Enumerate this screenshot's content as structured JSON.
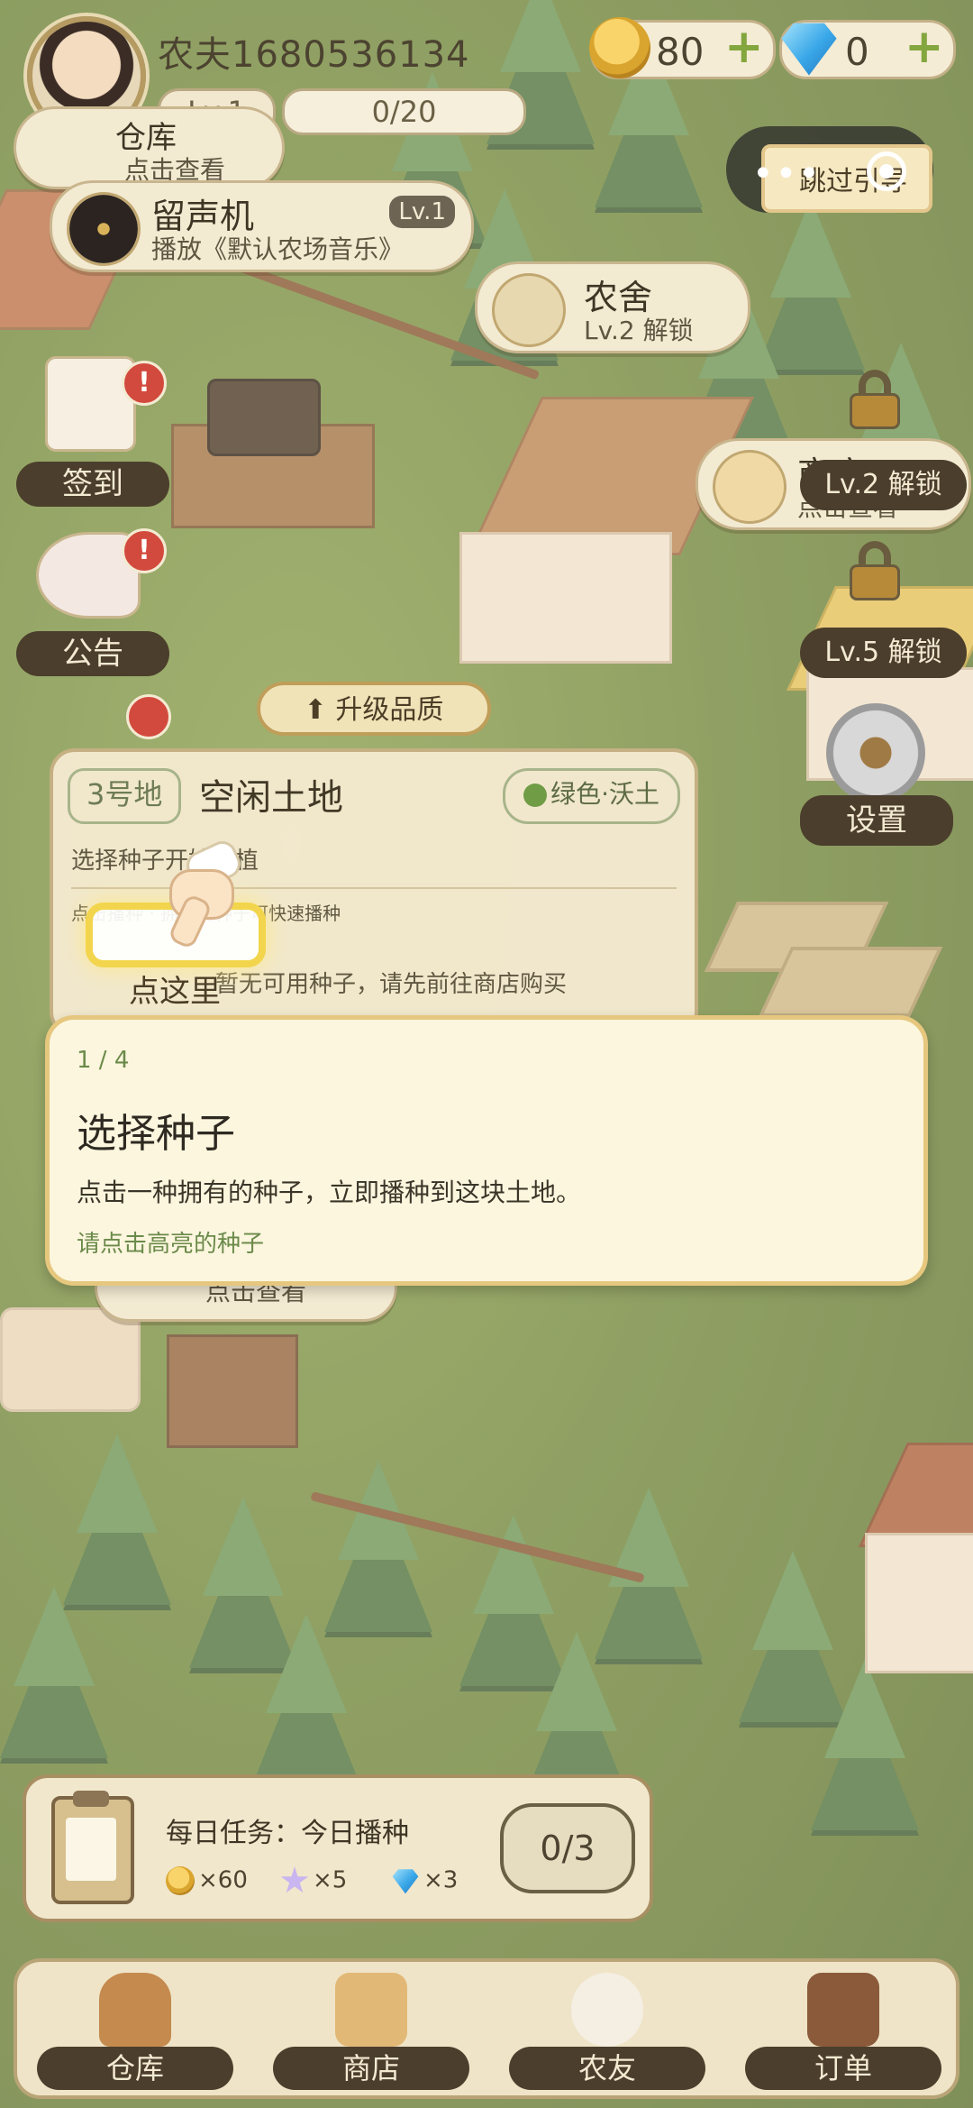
{
  "player": {
    "name": "农夫1680536134",
    "level": "Lv.1",
    "xp": "0/20"
  },
  "resources": {
    "coins": "80",
    "gems": "0"
  },
  "skip": {
    "label": "跳过引导"
  },
  "buildings": {
    "warehouse": {
      "title": "仓库",
      "sub": "点击查看"
    },
    "gramophone": {
      "title": "留声机",
      "sub": "播放《默认农场音乐》",
      "level": "Lv.1"
    },
    "farmhouse": {
      "title": "农舍",
      "sub": "Lv.2 解锁"
    },
    "shop": {
      "title": "商店",
      "sub": "点击查看"
    },
    "bottom": {
      "sub": "点击查看"
    }
  },
  "side": {
    "checkin": "签到",
    "notice": "公告",
    "settings": "设置",
    "lock_lv2": "Lv.2 解锁",
    "lock_lv5": "Lv.5 解锁"
  },
  "upgrade": "升级品质",
  "plot": {
    "id": "3号地",
    "title": "空闲土地",
    "soil": "绿色·沃土",
    "hint": "选择种子开始种植",
    "sub": "点击播种 · 拥有的种子可快速播种",
    "empty": "暂无可用种子，请先前往商店购买",
    "tap_here": "点这里"
  },
  "tutorial": {
    "step": "1 / 4",
    "title": "选择种子",
    "desc": "点击一种拥有的种子，立即播种到这块土地。",
    "cta": "请点击高亮的种子"
  },
  "daily_task": {
    "title": "每日任务：今日播种",
    "rewards": [
      {
        "icon": "coin-icon",
        "text": "×60"
      },
      {
        "icon": "exp-star-icon",
        "text": "×5"
      },
      {
        "icon": "gem-icon",
        "text": "×3"
      }
    ],
    "progress": "0/3"
  },
  "nav": [
    {
      "label": "仓库",
      "icon": "backpack-icon"
    },
    {
      "label": "商店",
      "icon": "shopping-bag-icon"
    },
    {
      "label": "农友",
      "icon": "friends-icon"
    },
    {
      "label": "订单",
      "icon": "order-board-icon"
    }
  ],
  "colors": {
    "accent": "#6b8a4a",
    "highlight": "#f2d54c",
    "panel": "#f4ead0",
    "dark_label": "#4b3e2c",
    "badge": "#d24a3d"
  }
}
